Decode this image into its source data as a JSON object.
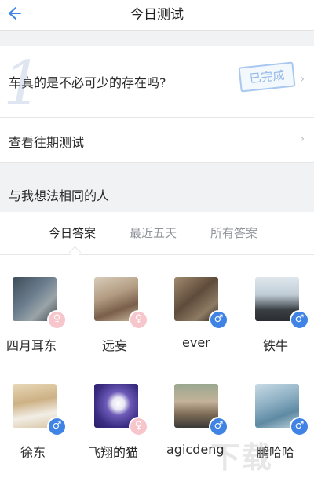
{
  "header": {
    "title": "今日测试",
    "back_icon": "arrow-left-icon"
  },
  "question": {
    "number": "1",
    "text": "车真的是不必可少的存在吗?",
    "status": "已完成"
  },
  "past_tests": {
    "label": "查看往期测试"
  },
  "same_minded": {
    "title": "与我想法相同的人",
    "tabs": [
      {
        "label": "今日答案",
        "active": true
      },
      {
        "label": "最近五天",
        "active": false
      },
      {
        "label": "所有答案",
        "active": false
      }
    ]
  },
  "users": [
    {
      "name": "四月耳东",
      "gender": "female",
      "avatar_color": "#5a6a78"
    },
    {
      "name": "远妄",
      "gender": "female",
      "avatar_color": "#b7a38c"
    },
    {
      "name": "ever",
      "gender": "male",
      "avatar_color": "#8c7860"
    },
    {
      "name": "铁牛",
      "gender": "male",
      "avatar_color": "#c5d1da"
    },
    {
      "name": "徐东",
      "gender": "male",
      "avatar_color": "#d8c3a5"
    },
    {
      "name": "飞翔的猫",
      "gender": "female",
      "avatar_color": "#4b3d8f"
    },
    {
      "name": "agicdeng",
      "gender": "male",
      "avatar_color": "#7c8a76"
    },
    {
      "name": "鹏哈哈",
      "gender": "male",
      "avatar_color": "#8fb1c4"
    }
  ],
  "colors": {
    "accent": "#3f84e5",
    "female": "#f6c6cc",
    "background": "#f1f2f4"
  }
}
